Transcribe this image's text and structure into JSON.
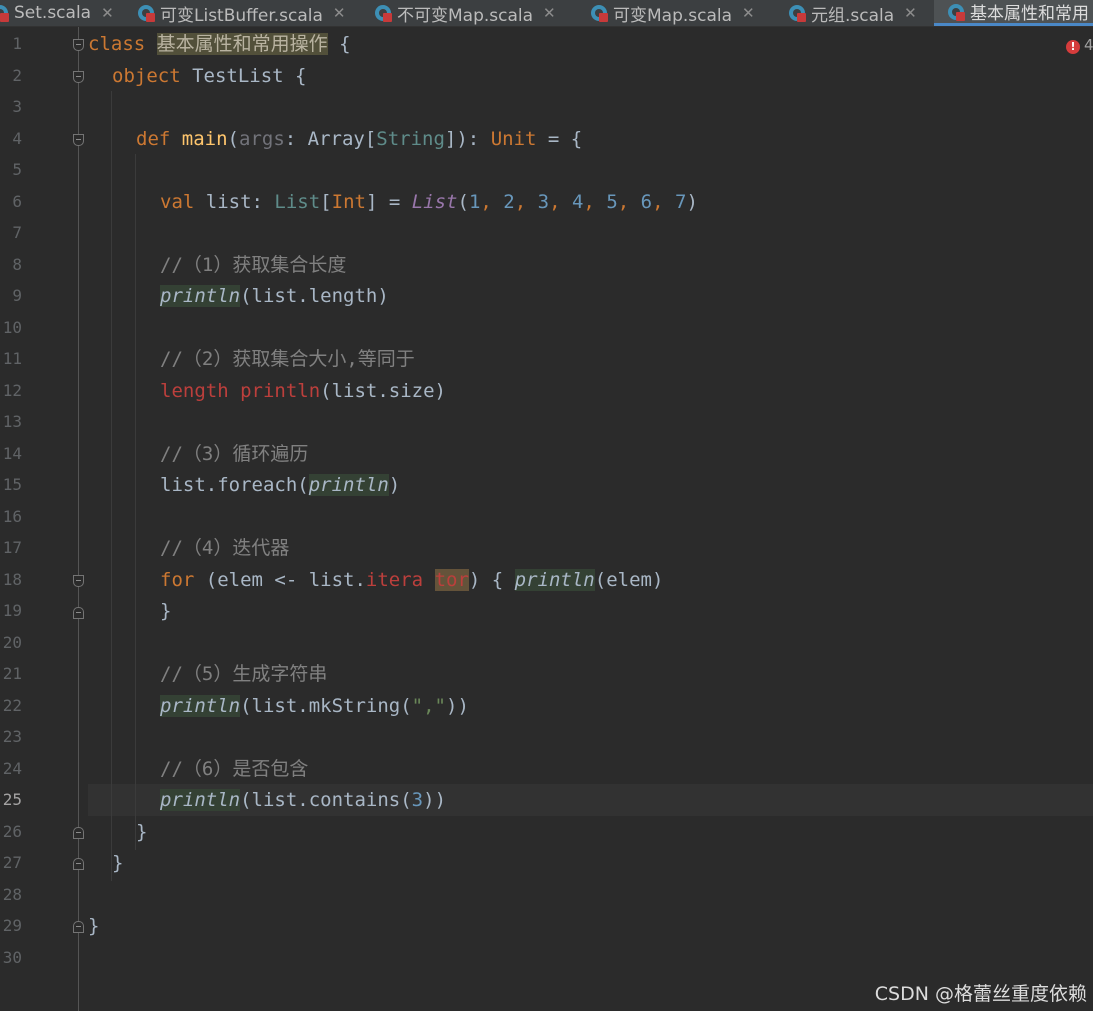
{
  "tabs": [
    {
      "label": "Set.scala",
      "active": false
    },
    {
      "label": "可变ListBuffer.scala",
      "active": false
    },
    {
      "label": "不可变Map.scala",
      "active": false
    },
    {
      "label": "可变Map.scala",
      "active": false
    },
    {
      "label": "元组.scala",
      "active": false
    },
    {
      "label": "基本属性和常用",
      "active": true
    }
  ],
  "tab_close_glyph": "✕",
  "file_icon": "scala-file-icon",
  "inspection": {
    "icon": "error-icon",
    "count": "4"
  },
  "line_numbers": [
    "1",
    "2",
    "3",
    "4",
    "5",
    "6",
    "7",
    "8",
    "9",
    "10",
    "11",
    "12",
    "13",
    "14",
    "15",
    "16",
    "17",
    "18",
    "19",
    "20",
    "21",
    "22",
    "23",
    "24",
    "25",
    "26",
    "27",
    "28",
    "29",
    "30"
  ],
  "current_line": 25,
  "code": {
    "l1": {
      "kw": "class",
      "name": "基本属性和常用操作",
      "rest": " {"
    },
    "l2": {
      "kw": "object",
      "rest": " TestList {"
    },
    "l4": {
      "kw": "def",
      "fn": "main",
      "p1": "(",
      "param": "args",
      "p2": ": Array[",
      "typ": "String",
      "p3": "]): ",
      "unit": "Unit",
      "p4": " = {"
    },
    "l6": {
      "kw": "val",
      "a": " list: ",
      "t1": "List",
      "b": "[",
      "t2": "Int",
      "c": "] = ",
      "obj": "List",
      "d": "(",
      "n1": "1",
      "s1": ", ",
      "n2": "2",
      "s2": ", ",
      "n3": "3",
      "s3": ", ",
      "n4": "4",
      "s4": ", ",
      "n5": "5",
      "s5": ", ",
      "n6": "6",
      "s6": ", ",
      "n7": "7",
      "e": ")"
    },
    "l8": {
      "text": "//（1）获取集合长度"
    },
    "l9": {
      "fn": "println",
      "rest": "(list.length)"
    },
    "l11": {
      "text": "//（2）获取集合大小,等同于"
    },
    "l12": {
      "err1": "length",
      "sp": " ",
      "err2": "println",
      "rest": "(list.size)"
    },
    "l14": {
      "text": "//（3）循环遍历"
    },
    "l15": {
      "a": "list.foreach(",
      "fn": "println",
      "b": ")"
    },
    "l17": {
      "text": "//（4）迭代器"
    },
    "l18": {
      "kw": "for",
      "a": " (elem <- list.",
      "err1": "itera",
      "sp": " ",
      "err2": "tor",
      "b": ") { ",
      "fn": "println",
      "c": "(elem)"
    },
    "l19": {
      "text": "}"
    },
    "l21": {
      "text": "//（5）生成字符串"
    },
    "l22": {
      "fn": "println",
      "a": "(list.mkString(",
      "str": "\",\"",
      "b": "))"
    },
    "l24": {
      "text": "//（6）是否包含"
    },
    "l25": {
      "fn": "println",
      "a": "(list.contains(",
      "num": "3",
      "b": "))"
    },
    "l26": {
      "text": "}"
    },
    "l27": {
      "text": "}"
    },
    "l29": {
      "text": "}"
    }
  },
  "colors": {
    "background": "#2b2b2b",
    "keyword": "#cc7832",
    "function": "#ffc66d",
    "number": "#6897bb",
    "string": "#6a8759",
    "comment": "#808080",
    "error": "#bc3f3c",
    "tab_accent": "#4a88c7"
  },
  "watermark": "CSDN @格蕾丝重度依赖"
}
